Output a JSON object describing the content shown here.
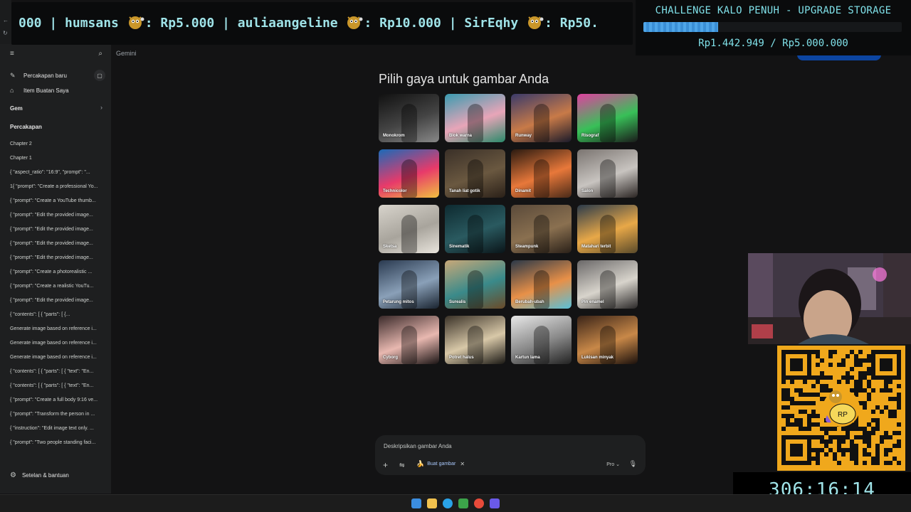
{
  "colors": {
    "accent": "#a8c7fa",
    "overlay_text": "#9fe3e8",
    "progress": "#4ea5e8",
    "qr_bg": "#f0a81c"
  },
  "ticker": {
    "text_parts": [
      "000 | humsans ",
      ": Rp5.000 | auliaangeline ",
      ": Rp10.000 | SirEqhy ",
      ": Rp50."
    ],
    "emoji_icon": "mascot-emoji-icon"
  },
  "challenge": {
    "title": "CHALLENGE KALO PENUH - UPGRADE STORAGE",
    "progress_fraction": 0.2886,
    "amount": "Rp1.442.949 / Rp5.000.000"
  },
  "timer": "306:16:14",
  "sidebar": {
    "menu_icon": "hamburger-icon",
    "search_icon": "search-icon",
    "new_chat": "Percakapan baru",
    "my_items": "Item Buatan Saya",
    "gem_section": "Gem",
    "chats_section": "Percakapan",
    "items": [
      "Chapter 2",
      "Chapter 1",
      "{   \"aspect_ratio\": \"16:9\",   \"prompt\": \"...",
      "1{ \"prompt\": \"Create a professional Yo...",
      "{ \"prompt\": \"Create a YouTube thumb...",
      "{   \"prompt\": \"Edit the provided image...",
      "{   \"prompt\": \"Edit the provided image...",
      "{   \"prompt\": \"Edit the provided image...",
      "{   \"prompt\": \"Edit the provided image...",
      "{   \"prompt\": \"Create a photorealistic ...",
      "{   \"prompt\": \"Create a realistic YouTu...",
      "{   \"prompt\": \"Edit the provided image...",
      "{   \"contents\": [     {       \"parts\": [         {...",
      "Generate image based on reference i...",
      "Generate image based on reference i...",
      "Generate image based on reference i...",
      "{ \"contents\": [ { \"parts\": [ { \"text\": \"En...",
      "{ \"contents\": [ { \"parts\": [ { \"text\": \"En...",
      "{ \"prompt\": \"Create a full body 9:16 ve...",
      "{ \"prompt\": \"Transform the person in ...",
      "{ \"instruction\": \"Edit image text only. ...",
      "{ \"prompt\": \"Two people standing faci..."
    ],
    "settings": "Setelan & bantuan"
  },
  "app_label": "Gemini",
  "main": {
    "heading": "Pilih gaya untuk gambar Anda",
    "styles": [
      "Monokrom",
      "Blok warna",
      "Runway",
      "Risograf",
      "Technicolor",
      "Tanah liat gotik",
      "Dinamit",
      "Salon",
      "Sketsa",
      "Sinematik",
      "Steampunk",
      "Matahari terbit",
      "Petarung mitos",
      "Surealis",
      "Berubah-ubah",
      "Pin enamel",
      "Cyborg",
      "Potret halus",
      "Kartun lama",
      "Lukisan minyak"
    ]
  },
  "prompt": {
    "placeholder": "Deskripsikan gambar Anda",
    "chip_label": "Buat gambar",
    "model": "Pro"
  }
}
